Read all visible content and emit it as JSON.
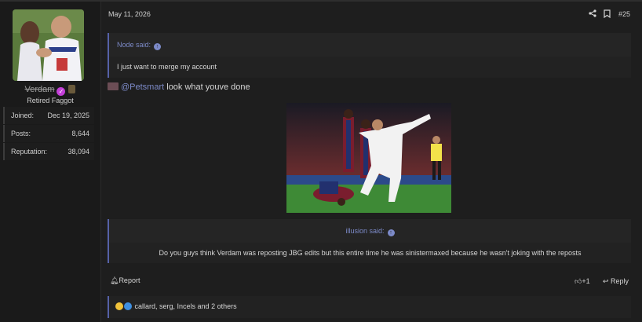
{
  "user": {
    "name": "Verdam",
    "title": "Retired Faggot",
    "stats": [
      {
        "label": "Joined:",
        "value": "Dec 19, 2025"
      },
      {
        "label": "Posts:",
        "value": "8,644"
      },
      {
        "label": "Reputation:",
        "value": "38,094"
      }
    ]
  },
  "post": {
    "date": "May 11, 2026",
    "number": "#25",
    "quote1": {
      "author": "Node said:",
      "text": "I just want to merge my account"
    },
    "mention": "@Petsmart",
    "message": " look what youve done",
    "quote2": {
      "author": "illusion said:",
      "text": "Do you guys think Verdam was reposting JBG edits but this entire time he was sinistermaxed because he wasn't joking with the reposts"
    },
    "actions": {
      "report": "Report",
      "likes": "+1",
      "reply": "Reply"
    },
    "reactions": "callard, serg, Incels and 2 others"
  },
  "colors": {
    "accent": "#7c8ac8",
    "background": "#1e1e1e"
  }
}
